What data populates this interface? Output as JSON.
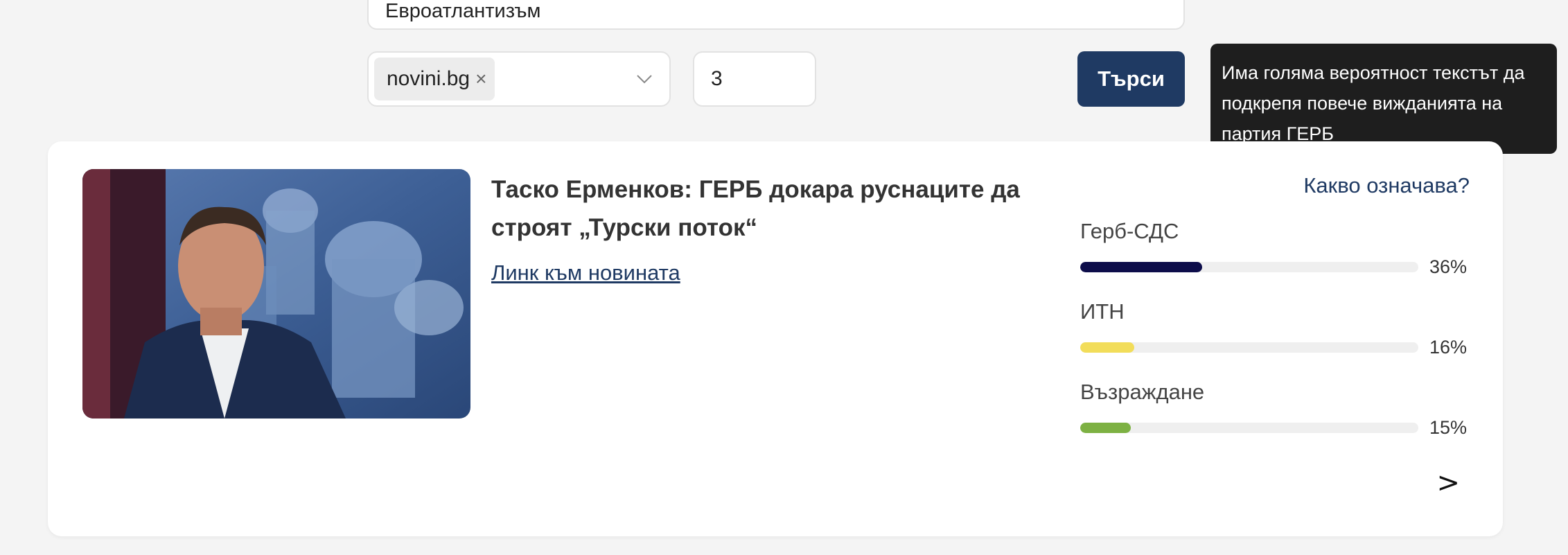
{
  "search": {
    "topic_value": "Евроатлантизъм",
    "source_tag": "novini.bg",
    "count_value": "3",
    "submit_label": "Търси"
  },
  "tooltip": {
    "text": "Има голяма вероятност текстът да подкрепя повече вижданията на партия ГЕРБ"
  },
  "article": {
    "title": "Таско Ерменков: ГЕРБ докара руснаците да строят „Турски поток“",
    "link_label": "Линк към новината",
    "meaning_label": "Какво означава?",
    "next_label": ">",
    "parties": [
      {
        "name": "Герб-СДС",
        "percent_label": "36%",
        "value": 0.36,
        "color": "#0d0d4a"
      },
      {
        "name": "ИТН",
        "percent_label": "16%",
        "value": 0.16,
        "color": "#f2dd5a"
      },
      {
        "name": "Възраждане",
        "percent_label": "15%",
        "value": 0.15,
        "color": "#7db143"
      }
    ]
  },
  "icons": {
    "tag_remove": "close-icon",
    "dropdown": "chevron-down-icon"
  }
}
